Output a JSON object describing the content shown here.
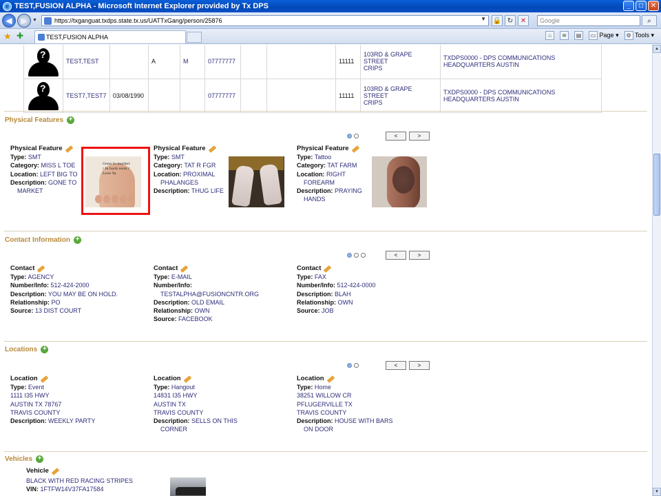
{
  "window": {
    "title": "TEST,FUSION ALPHA - Microsoft Internet Explorer provided by Tx DPS",
    "url": "https://txganguat.txdps.state.tx.us/UATTxGang/person/25876",
    "search_placeholder": "Google",
    "tab_title": "TEST,FUSION ALPHA",
    "cmd_page": "Page",
    "cmd_tools": "Tools"
  },
  "persons": [
    {
      "name": "TEST,TEST",
      "dob": "",
      "race": "A",
      "sex": "M",
      "phone": "07777777",
      "zip": "11111",
      "gang_line1": "103RD & GRAPE STREET",
      "gang_line2": "CRIPS",
      "agency_line1": "TXDPS0000 - DPS COMMUNICATIONS",
      "agency_line2": "HEADQUARTERS AUSTIN"
    },
    {
      "name": "TEST7,TEST7",
      "dob": "03/08/1990",
      "race": "",
      "sex": "",
      "phone": "07777777",
      "zip": "11111",
      "gang_line1": "103RD & GRAPE STREET",
      "gang_line2": "CRIPS",
      "agency_line1": "TXDPS0000 - DPS COMMUNICATIONS",
      "agency_line2": "HEADQUARTERS AUSTIN"
    }
  ],
  "pager": {
    "prev": "<",
    "next": ">"
  },
  "physical_features": {
    "title": "Physical Features",
    "items": [
      {
        "heading": "Physical Feature",
        "type_label": "Type:",
        "type": "SMT",
        "category_label": "Category:",
        "category": "MISS L TOE",
        "location_label": "Location:",
        "location": "LEFT BIG TO",
        "location_2": "",
        "description_label": "Description:",
        "description": "GONE TO",
        "description_2": "MARKET",
        "photo_text": "Gone to market / In back soon / Love Ya"
      },
      {
        "heading": "Physical Feature",
        "type_label": "Type:",
        "type": "SMT",
        "category_label": "Category:",
        "category": "TAT R FGR",
        "location_label": "Location:",
        "location": "PROXIMAL",
        "location_2": "PHALANGES",
        "description_label": "Description:",
        "description": "THUG LIFE",
        "description_2": ""
      },
      {
        "heading": "Physical Feature",
        "type_label": "Type:",
        "type": "Tattoo",
        "category_label": "Category:",
        "category": "TAT FARM",
        "location_label": "Location:",
        "location": "RIGHT",
        "location_2": "FOREARM",
        "description_label": "Description:",
        "description": "PRAYING",
        "description_2": "HANDS"
      }
    ]
  },
  "contacts": {
    "title": "Contact Information",
    "items": [
      {
        "heading": "Contact",
        "type_label": "Type:",
        "type": "AGENCY",
        "number_label": "Number/Info:",
        "number": "512-424-2000",
        "number_2": "",
        "description_label": "Description:",
        "description": "YOU MAY BE ON HOLD.",
        "relationship_label": "Relationship:",
        "relationship": "PO",
        "source_label": "Source:",
        "source": "13 DIST COURT"
      },
      {
        "heading": "Contact",
        "type_label": "Type:",
        "type": "E-MAIL",
        "number_label": "Number/Info:",
        "number": "",
        "number_2": "TESTALPHA@FUSIONCNTR.ORG",
        "description_label": "Description:",
        "description": "OLD EMAIL",
        "relationship_label": "Relationship:",
        "relationship": "OWN",
        "source_label": "Source:",
        "source": "FACEBOOK"
      },
      {
        "heading": "Contact",
        "type_label": "Type:",
        "type": "FAX",
        "number_label": "Number/Info:",
        "number": "512-424-0000",
        "number_2": "",
        "description_label": "Description:",
        "description": "BLAH",
        "relationship_label": "Relationship:",
        "relationship": "OWN",
        "source_label": "Source:",
        "source": "JOB"
      }
    ]
  },
  "locations": {
    "title": "Locations",
    "items": [
      {
        "heading": "Location",
        "type_label": "Type:",
        "type": "Event",
        "line1": "1111 I35 HWY",
        "line2": "AUSTIN TX 78767",
        "line3": "TRAVIS COUNTY",
        "description_label": "Description:",
        "description": "WEEKLY PARTY",
        "description_2": ""
      },
      {
        "heading": "Location",
        "type_label": "Type:",
        "type": "Hangout",
        "line1": "14831 I35 HWY",
        "line2": "AUSTIN TX",
        "line3": "TRAVIS COUNTY",
        "description_label": "Description:",
        "description": "SELLS ON THIS",
        "description_2": "CORNER"
      },
      {
        "heading": "Location",
        "type_label": "Type:",
        "type": "Home",
        "line1": "38251 WILLOW CR",
        "line2": "PFLUGERVILLE TX",
        "line3": "TRAVIS COUNTY",
        "description_label": "Description:",
        "description": "HOUSE WITH BARS",
        "description_2": "ON DOOR"
      }
    ]
  },
  "vehicles": {
    "title": "Vehicles",
    "heading": "Vehicle",
    "description": "BLACK WITH RED RACING STRIPES",
    "vin_label": "VIN:",
    "vin": "1FTFW14V37FA17584"
  },
  "colors": {
    "section_title": "#b78a3b",
    "link": "#2c2c7a",
    "highlight": "#e11111",
    "title_bar": "#0a5fd8"
  }
}
